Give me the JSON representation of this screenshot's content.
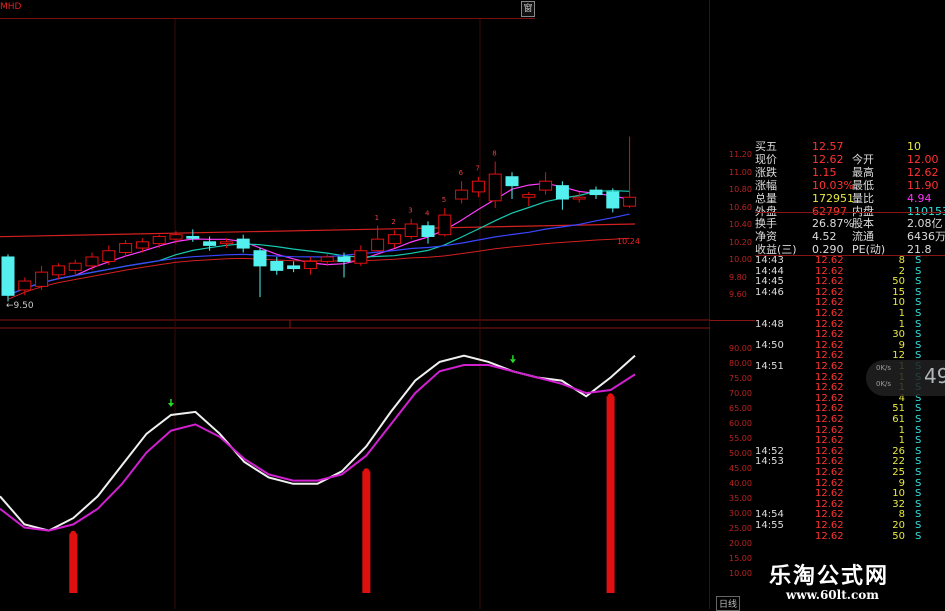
{
  "topbar": {
    "label": "MHD",
    "button": "窗"
  },
  "candle_axis": [
    "11.20",
    "11.00",
    "10.80",
    "10.60",
    "10.40",
    "10.20",
    "10.00",
    "9.80",
    "9.60"
  ],
  "osc_axis": [
    "90.00",
    "80.00",
    "75.00",
    "70.00",
    "65.00",
    "60.00",
    "55.00",
    "50.00",
    "45.00",
    "40.00",
    "35.00",
    "30.00",
    "25.00",
    "20.00",
    "15.00",
    "10.00"
  ],
  "low_label": "9.50",
  "ma_label": "10.24",
  "candle_seq": [
    "1",
    "2",
    "3",
    "4",
    "5",
    "6",
    "7",
    "8"
  ],
  "quote": {
    "r1": {
      "k": "买五",
      "v": "12.57",
      "v2": "10"
    },
    "r2": {
      "k": "现价",
      "v": "12.62",
      "k2": "今开",
      "v2": "12.00"
    },
    "r3": {
      "k": "涨跌",
      "v": "1.15",
      "k2": "最高",
      "v2": "12.62"
    },
    "r4": {
      "k": "涨幅",
      "v": "10.03%",
      "k2": "最低",
      "v2": "11.90"
    },
    "r5": {
      "k": "总量",
      "v": "172951",
      "k2": "量比",
      "v2": "4.94"
    },
    "r6": {
      "k": "外盘",
      "v": "62797",
      "k2": "内盘",
      "v2": "110153"
    },
    "r7": {
      "k": "换手",
      "v": "26.87%",
      "k2": "股本",
      "v2": "2.08亿"
    },
    "r8": {
      "k": "净资",
      "v": "4.52",
      "k2": "流通",
      "v2": "6436万"
    },
    "r9": {
      "k": "收益(三)",
      "v": "0.290",
      "k2": "PE(动)",
      "v2": "21.8"
    }
  },
  "ticks": [
    {
      "t": "14:43",
      "p": "12.62",
      "q": "8",
      "s": "S"
    },
    {
      "t": "14:44",
      "p": "12.62",
      "q": "2",
      "s": "S"
    },
    {
      "t": "14:45",
      "p": "12.62",
      "q": "50",
      "s": "S"
    },
    {
      "t": "14:46",
      "p": "12.62",
      "q": "15",
      "s": "S"
    },
    {
      "t": "",
      "p": "12.62",
      "q": "10",
      "s": "S"
    },
    {
      "t": "",
      "p": "12.62",
      "q": "1",
      "s": "S"
    },
    {
      "t": "14:48",
      "p": "12.62",
      "q": "1",
      "s": "S"
    },
    {
      "t": "",
      "p": "12.62",
      "q": "30",
      "s": "S"
    },
    {
      "t": "14:50",
      "p": "12.62",
      "q": "9",
      "s": "S"
    },
    {
      "t": "",
      "p": "12.62",
      "q": "12",
      "s": "S"
    },
    {
      "t": "14:51",
      "p": "12.62",
      "q": "1",
      "s": "S"
    },
    {
      "t": "",
      "p": "12.62",
      "q": "1",
      "s": "S"
    },
    {
      "t": "",
      "p": "12.62",
      "q": "1",
      "s": "S"
    },
    {
      "t": "",
      "p": "12.62",
      "q": "4",
      "s": "S"
    },
    {
      "t": "",
      "p": "12.62",
      "q": "51",
      "s": "S"
    },
    {
      "t": "",
      "p": "12.62",
      "q": "61",
      "s": "S"
    },
    {
      "t": "",
      "p": "12.62",
      "q": "1",
      "s": "S"
    },
    {
      "t": "",
      "p": "12.62",
      "q": "1",
      "s": "S"
    },
    {
      "t": "14:52",
      "p": "12.62",
      "q": "26",
      "s": "S"
    },
    {
      "t": "14:53",
      "p": "12.62",
      "q": "22",
      "s": "S"
    },
    {
      "t": "",
      "p": "12.62",
      "q": "25",
      "s": "S"
    },
    {
      "t": "",
      "p": "12.62",
      "q": "9",
      "s": "S"
    },
    {
      "t": "",
      "p": "12.62",
      "q": "10",
      "s": "S"
    },
    {
      "t": "",
      "p": "12.62",
      "q": "32",
      "s": "S"
    },
    {
      "t": "14:54",
      "p": "12.62",
      "q": "8",
      "s": "S"
    },
    {
      "t": "14:55",
      "p": "12.62",
      "q": "20",
      "s": "S"
    },
    {
      "t": "",
      "p": "12.62",
      "q": "50",
      "s": "S"
    }
  ],
  "widget": {
    "big": "49",
    "s1": "0K/s",
    "s2": "0K/s"
  },
  "watermark": {
    "cn": "乐淘公式网",
    "url": "www.60lt.com"
  },
  "corner": "日线",
  "colors": {
    "up": "#e01010",
    "down": "#54f0f0",
    "frame": "#8a1515",
    "ma1": "#ff3cff",
    "ma2": "#16c9b0",
    "ma3": "#3a46ff",
    "ma4": "#d42020"
  },
  "candles": [
    {
      "o": 10.05,
      "c": 9.62,
      "h": 10.08,
      "l": 9.55
    },
    {
      "o": 9.68,
      "c": 9.78,
      "h": 9.82,
      "l": 9.62
    },
    {
      "o": 9.72,
      "c": 9.88,
      "h": 9.95,
      "l": 9.68
    },
    {
      "o": 9.85,
      "c": 9.95,
      "h": 9.98,
      "l": 9.8
    },
    {
      "o": 9.9,
      "c": 9.98,
      "h": 10.02,
      "l": 9.85
    },
    {
      "o": 9.95,
      "c": 10.05,
      "h": 10.1,
      "l": 9.9
    },
    {
      "o": 10.0,
      "c": 10.12,
      "h": 10.18,
      "l": 9.96
    },
    {
      "o": 10.1,
      "c": 10.2,
      "h": 10.24,
      "l": 10.05
    },
    {
      "o": 10.15,
      "c": 10.22,
      "h": 10.26,
      "l": 10.1
    },
    {
      "o": 10.2,
      "c": 10.28,
      "h": 10.3,
      "l": 10.15
    },
    {
      "o": 10.25,
      "c": 10.3,
      "h": 10.34,
      "l": 10.2
    },
    {
      "o": 10.28,
      "c": 10.26,
      "h": 10.36,
      "l": 10.22
    },
    {
      "o": 10.22,
      "c": 10.18,
      "h": 10.28,
      "l": 10.12
    },
    {
      "o": 10.2,
      "c": 10.22,
      "h": 10.26,
      "l": 10.15
    },
    {
      "o": 10.25,
      "c": 10.15,
      "h": 10.3,
      "l": 10.1
    },
    {
      "o": 10.12,
      "c": 9.95,
      "h": 10.15,
      "l": 9.6
    },
    {
      "o": 10.0,
      "c": 9.9,
      "h": 10.05,
      "l": 9.85
    },
    {
      "o": 9.95,
      "c": 9.92,
      "h": 10.0,
      "l": 9.88
    },
    {
      "o": 9.92,
      "c": 10.0,
      "h": 10.05,
      "l": 9.85
    },
    {
      "o": 10.0,
      "c": 10.05,
      "h": 10.08,
      "l": 9.95
    },
    {
      "o": 10.05,
      "c": 10.0,
      "h": 10.1,
      "l": 9.82
    },
    {
      "o": 9.98,
      "c": 10.12,
      "h": 10.18,
      "l": 9.95
    },
    {
      "o": 10.12,
      "c": 10.25,
      "h": 10.4,
      "l": 10.1
    },
    {
      "o": 10.2,
      "c": 10.3,
      "h": 10.35,
      "l": 10.15
    },
    {
      "o": 10.28,
      "c": 10.42,
      "h": 10.48,
      "l": 10.25
    },
    {
      "o": 10.4,
      "c": 10.28,
      "h": 10.45,
      "l": 10.2
    },
    {
      "o": 10.3,
      "c": 10.52,
      "h": 10.6,
      "l": 10.28
    },
    {
      "o": 10.7,
      "c": 10.8,
      "h": 10.9,
      "l": 10.65
    },
    {
      "o": 10.78,
      "c": 10.9,
      "h": 10.95,
      "l": 10.72
    },
    {
      "o": 10.68,
      "c": 10.98,
      "h": 11.12,
      "l": 10.6
    },
    {
      "o": 10.95,
      "c": 10.85,
      "h": 11.0,
      "l": 10.7
    },
    {
      "o": 10.72,
      "c": 10.75,
      "h": 10.78,
      "l": 10.62
    },
    {
      "o": 10.8,
      "c": 10.9,
      "h": 11.0,
      "l": 10.75
    },
    {
      "o": 10.85,
      "c": 10.7,
      "h": 10.9,
      "l": 10.58
    },
    {
      "o": 10.7,
      "c": 10.72,
      "h": 10.78,
      "l": 10.66
    },
    {
      "o": 10.8,
      "c": 10.75,
      "h": 10.84,
      "l": 10.7
    },
    {
      "o": 10.78,
      "c": 10.6,
      "h": 10.82,
      "l": 10.55
    },
    {
      "o": 10.62,
      "c": 10.72,
      "h": 11.4,
      "l": 10.6
    }
  ],
  "osc": {
    "white": [
      40,
      31,
      29,
      33,
      40,
      50,
      60,
      66,
      67,
      60,
      51,
      46,
      44,
      44,
      48,
      56,
      67,
      77,
      83,
      85,
      83,
      80,
      78,
      77,
      72,
      78,
      85
    ],
    "magenta": [
      36,
      30,
      29,
      31,
      36,
      44,
      54,
      61,
      63,
      59,
      52,
      47,
      45,
      45,
      47,
      53,
      63,
      73,
      80,
      82,
      82,
      80,
      78,
      76,
      73,
      74,
      79
    ],
    "bars": [
      {
        "i": 3,
        "v": 28
      },
      {
        "i": 15,
        "v": 48
      },
      {
        "i": 25,
        "v": 72
      }
    ],
    "arrows": [
      7,
      21
    ]
  }
}
